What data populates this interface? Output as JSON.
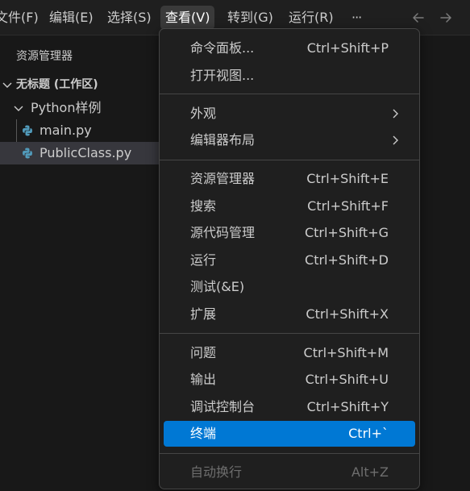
{
  "menubar": {
    "items": [
      {
        "label": "文件(F)"
      },
      {
        "label": "编辑(E)"
      },
      {
        "label": "选择(S)"
      },
      {
        "label": "查看(V)"
      },
      {
        "label": "转到(G)"
      },
      {
        "label": "运行(R)"
      },
      {
        "label": "···"
      }
    ],
    "active_index": 3,
    "nav": {
      "back_icon": "arrow-left-icon",
      "forward_icon": "arrow-right-icon"
    }
  },
  "explorer": {
    "title": "资源管理器",
    "workspace": "无标题 (工作区)",
    "folder": "Python样例",
    "files": [
      {
        "name": "main.py",
        "icon": "python-file-icon"
      },
      {
        "name": "PublicClass.py",
        "icon": "python-file-icon",
        "selected": true
      }
    ]
  },
  "view_menu": {
    "groups": [
      [
        {
          "label": "命令面板...",
          "shortcut": "Ctrl+Shift+P"
        },
        {
          "label": "打开视图...",
          "shortcut": ""
        }
      ],
      [
        {
          "label": "外观",
          "shortcut": "",
          "submenu": true
        },
        {
          "label": "编辑器布局",
          "shortcut": "",
          "submenu": true
        }
      ],
      [
        {
          "label": "资源管理器",
          "shortcut": "Ctrl+Shift+E"
        },
        {
          "label": "搜索",
          "shortcut": "Ctrl+Shift+F"
        },
        {
          "label": "源代码管理",
          "shortcut": "Ctrl+Shift+G"
        },
        {
          "label": "运行",
          "shortcut": "Ctrl+Shift+D"
        },
        {
          "label": "测试(&E)",
          "shortcut": ""
        },
        {
          "label": "扩展",
          "shortcut": "Ctrl+Shift+X"
        }
      ],
      [
        {
          "label": "问题",
          "shortcut": "Ctrl+Shift+M"
        },
        {
          "label": "输出",
          "shortcut": "Ctrl+Shift+U"
        },
        {
          "label": "调试控制台",
          "shortcut": "Ctrl+Shift+Y"
        },
        {
          "label": "终端",
          "shortcut": "Ctrl+`",
          "highlighted": true
        }
      ],
      [
        {
          "label": "自动换行",
          "shortcut": "Alt+Z",
          "disabled": true
        }
      ]
    ]
  },
  "colors": {
    "menubar_bg": "#1f1f1f",
    "sidebar_bg": "#181818",
    "menu_bg": "#1f1f1f",
    "highlight": "#0078d4",
    "selection": "#37373d",
    "python_blue": "#519aba",
    "text": "#cccccc",
    "disabled_text": "#6e6e6e"
  }
}
